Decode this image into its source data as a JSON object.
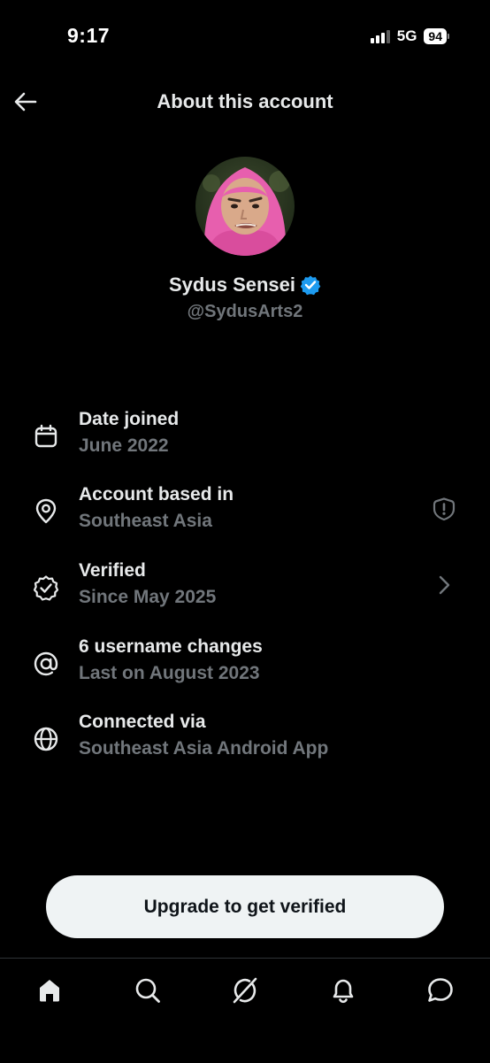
{
  "status_bar": {
    "time": "9:17",
    "network": "5G",
    "battery": "94"
  },
  "header": {
    "title": "About this account"
  },
  "profile": {
    "display_name": "Sydus Sensei",
    "handle": "@SydusArts2",
    "verified_color": "#1d9bf0"
  },
  "details": [
    {
      "icon": "calendar-icon",
      "title": "Date joined",
      "value": "June 2022"
    },
    {
      "icon": "location-pin-icon",
      "title": "Account based in",
      "value": "Southeast Asia",
      "trailing_icon": "shield-alert-icon"
    },
    {
      "icon": "verified-badge-icon",
      "title": "Verified",
      "value": "Since May 2025",
      "trailing_icon": "chevron-right-icon"
    },
    {
      "icon": "at-sign-icon",
      "title": "6 username changes",
      "value": "Last on August 2023"
    },
    {
      "icon": "globe-icon",
      "title": "Connected via",
      "value": "Southeast Asia Android App"
    }
  ],
  "upgrade_button": {
    "label": "Upgrade to get verified"
  },
  "bottom_nav": [
    {
      "icon": "home-icon"
    },
    {
      "icon": "search-icon"
    },
    {
      "icon": "grok-icon"
    },
    {
      "icon": "bell-icon"
    },
    {
      "icon": "messages-icon"
    }
  ],
  "colors": {
    "background": "#000000",
    "primary_text": "#e7e9ea",
    "secondary_text": "#71767b",
    "accent": "#1d9bf0",
    "button_bg": "#eff3f4"
  }
}
